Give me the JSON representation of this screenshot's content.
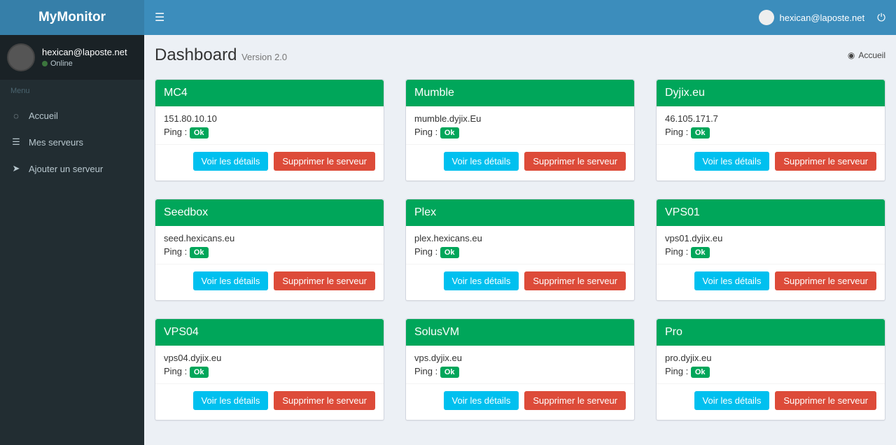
{
  "brand": "MyMonitor",
  "header": {
    "user_email": "hexican@laposte.net"
  },
  "sidebar": {
    "user_email": "hexican@laposte.net",
    "status": "Online",
    "menu_header": "Menu",
    "items": [
      {
        "label": "Accueil"
      },
      {
        "label": "Mes serveurs"
      },
      {
        "label": "Ajouter un serveur"
      }
    ]
  },
  "page": {
    "title": "Dashboard",
    "subtitle": "Version 2.0",
    "breadcrumb": "Accueil"
  },
  "labels": {
    "ping_prefix": "Ping :",
    "details": "Voir les détails",
    "delete": "Supprimer le serveur"
  },
  "servers": [
    {
      "name": "MC4",
      "address": "151.80.10.10",
      "ping": "Ok"
    },
    {
      "name": "Mumble",
      "address": "mumble.dyjix.Eu",
      "ping": "Ok"
    },
    {
      "name": "Dyjix.eu",
      "address": "46.105.171.7",
      "ping": "Ok"
    },
    {
      "name": "Seedbox",
      "address": "seed.hexicans.eu",
      "ping": "Ok"
    },
    {
      "name": "Plex",
      "address": "plex.hexicans.eu",
      "ping": "Ok"
    },
    {
      "name": "VPS01",
      "address": "vps01.dyjix.eu",
      "ping": "Ok"
    },
    {
      "name": "VPS04",
      "address": "vps04.dyjix.eu",
      "ping": "Ok"
    },
    {
      "name": "SolusVM",
      "address": "vps.dyjix.eu",
      "ping": "Ok"
    },
    {
      "name": "Pro",
      "address": "pro.dyjix.eu",
      "ping": "Ok"
    }
  ]
}
